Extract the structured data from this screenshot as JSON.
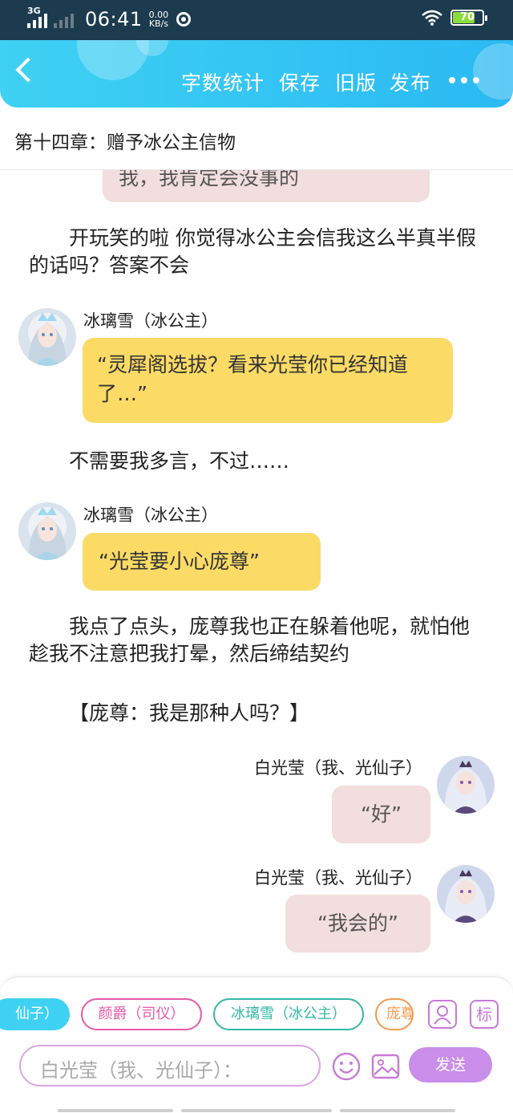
{
  "status_bar": {
    "network": "3G",
    "time": "06:41",
    "speed_value": "0.00",
    "speed_unit": "KB/s",
    "battery": "70"
  },
  "header": {
    "actions": [
      "字数统计",
      "保存",
      "旧版",
      "发布"
    ]
  },
  "chapter_title": "第十四章：赠予冰公主信物",
  "messages": {
    "m0_text": "我，我肯定会没事的",
    "p1": "开玩笑的啦 你觉得冰公主会信我这么半真半假的话吗？答案不会",
    "m2_speaker": "冰璃雪（冰公主）",
    "m2_text": "“灵犀阁选拔？看来光莹你已经知道了…”",
    "p3": "不需要我多言，不过……",
    "m4_speaker": "冰璃雪（冰公主）",
    "m4_text": "“光莹要小心庞尊”",
    "p5": "我点了点头，庞尊我也正在躲着他呢，就怕他趁我不注意把我打晕，然后缔结契约",
    "p6": "【庞尊：我是那种人吗？】",
    "m7_speaker": "白光莹（我、光仙子）",
    "m7_text": "“好”",
    "m8_speaker": "白光莹（我、光仙子）",
    "m8_text": "“我会的”"
  },
  "input_bar": {
    "chips": [
      "仙子）",
      "颜爵（司仪）",
      "冰璃雪（冰公主）",
      "庞尊"
    ],
    "role_button": "",
    "tag_button": "标",
    "input_placeholder": "白光莹（我、光仙子）：",
    "send_label": "发送"
  },
  "colors": {
    "header": "#2bb9f3",
    "yellow_bubble": "#fbdb66",
    "pink_bubble": "#f2dede",
    "accent_purple": "#c88ee9"
  }
}
